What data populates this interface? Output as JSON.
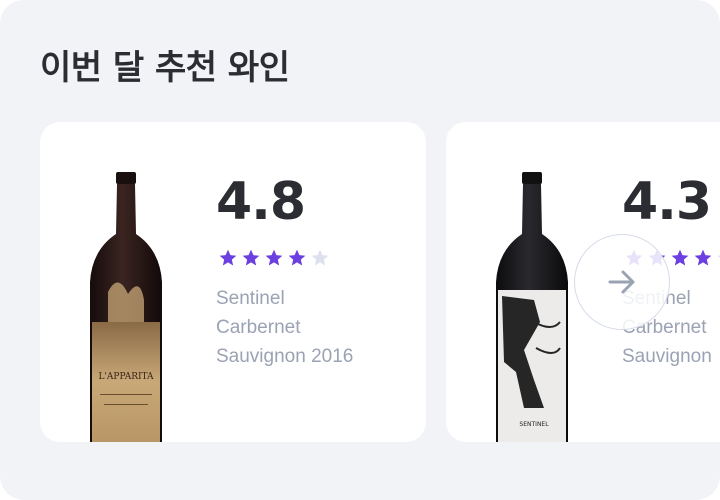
{
  "section": {
    "title": "이번 달 추천 와인"
  },
  "colors": {
    "star_filled": "#6b3fe0",
    "star_empty": "#dde1ee",
    "text_muted": "#9ba2b3"
  },
  "cards": [
    {
      "rating": "4.8",
      "stars": 4,
      "max_stars": 5,
      "name_lines": [
        "Sentinel",
        "Carbernet",
        "Sauvignon 2016"
      ],
      "label_text": "L'APPARITA"
    },
    {
      "rating": "4.3",
      "stars": 4,
      "max_stars": 5,
      "name_lines": [
        "Sentinel",
        "Carbernet",
        "Sauvignon"
      ],
      "label_text": "SENTINEL"
    }
  ],
  "carousel": {
    "next_icon": "arrow-right-icon"
  }
}
